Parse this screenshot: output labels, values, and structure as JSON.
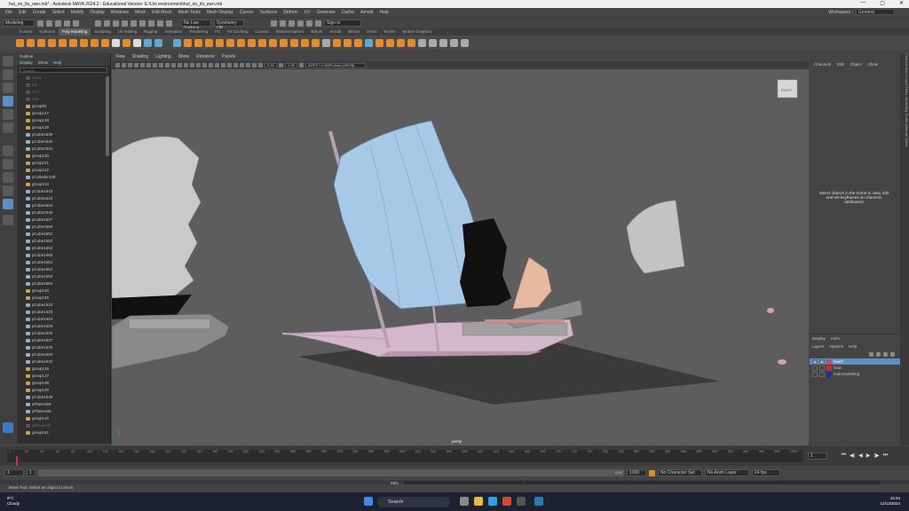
{
  "window": {
    "title": "hut_on_its_own.mb* - Autodesk MAYA 2024.2 - Educational Version: E:\\Uni environment\\hut_on_its_own.mb",
    "controls": [
      "—",
      "▢",
      "✕"
    ]
  },
  "menubar": {
    "items": [
      "File",
      "Edit",
      "Create",
      "Select",
      "Modify",
      "Display",
      "Windows",
      "Mesh",
      "Edit Mesh",
      "Mesh Tools",
      "Mesh Display",
      "Curves",
      "Surfaces",
      "Deform",
      "UV",
      "Generate",
      "Cache",
      "Arnold",
      "Help"
    ],
    "workspace_label": "Workspace :",
    "workspace_value": "General"
  },
  "statusline": {
    "mode": "Modeling",
    "live_surface": "No Live Surface",
    "symmetry": "Symmetry: Off",
    "sign_in": "Sign in"
  },
  "shelf_tabs": [
    "Curves",
    "Surfaces",
    "Poly Modeling",
    "Sculpting",
    "UV Editing",
    "Rigging",
    "Animation",
    "Rendering",
    "FX",
    "FX Caching",
    "Custom",
    "MotionGraphics",
    "Bifrost",
    "Arnold",
    "Bifrost",
    "XGen",
    "MASH",
    "Motion Graphics"
  ],
  "shelf_active": "Poly Modeling",
  "outliner": {
    "title": "Outliner",
    "menu": [
      "Display",
      "Show",
      "Help"
    ],
    "search_placeholder": "Search...",
    "rows": [
      {
        "label": "persp",
        "dim": true
      },
      {
        "label": "top",
        "dim": true
      },
      {
        "label": "front",
        "dim": true
      },
      {
        "label": "side",
        "dim": true
      },
      {
        "label": "group92",
        "grp": true
      },
      {
        "label": "group127",
        "grp": true
      },
      {
        "label": "group128",
        "grp": true
      },
      {
        "label": "group129",
        "grp": true
      },
      {
        "label": "pCube1539"
      },
      {
        "label": "pCube1540"
      },
      {
        "label": "pCube1541"
      },
      {
        "label": "group130",
        "grp": true
      },
      {
        "label": "group131",
        "grp": true
      },
      {
        "label": "group132",
        "grp": true
      },
      {
        "label": "pCylinder128"
      },
      {
        "label": "group133",
        "grp": true
      },
      {
        "label": "pCube1542"
      },
      {
        "label": "pCube1543"
      },
      {
        "label": "pCube1544"
      },
      {
        "label": "pCube1546"
      },
      {
        "label": "pCube1547"
      },
      {
        "label": "pCube1550"
      },
      {
        "label": "pCube1551"
      },
      {
        "label": "pCube1552"
      },
      {
        "label": "pCube1553"
      },
      {
        "label": "pCube1560"
      },
      {
        "label": "pCube1561"
      },
      {
        "label": "pCube1562"
      },
      {
        "label": "pCube1563"
      },
      {
        "label": "pCube1564"
      },
      {
        "label": "group134",
        "grp": true
      },
      {
        "label": "group135",
        "grp": true
      },
      {
        "label": "pCube1622"
      },
      {
        "label": "pCube1623"
      },
      {
        "label": "pCube1624"
      },
      {
        "label": "pCube1625"
      },
      {
        "label": "pCube1626"
      },
      {
        "label": "pCube1627"
      },
      {
        "label": "pCube1628"
      },
      {
        "label": "pCube1629"
      },
      {
        "label": "pCube1632"
      },
      {
        "label": "group136",
        "grp": true
      },
      {
        "label": "group137",
        "grp": true
      },
      {
        "label": "group138",
        "grp": true
      },
      {
        "label": "group139",
        "grp": true
      },
      {
        "label": "pCube1648"
      },
      {
        "label": "pPlane164"
      },
      {
        "label": "pPlane165"
      },
      {
        "label": "group140",
        "grp": true
      },
      {
        "label": "pPlane166",
        "dim": true
      },
      {
        "label": "group141",
        "grp": true
      }
    ]
  },
  "viewport": {
    "menu": [
      "View",
      "Shading",
      "Lighting",
      "Show",
      "Renderer",
      "Panels"
    ],
    "field_a": "0.00",
    "field_b": "1.00",
    "color_space": "ACES 1.0 SDR-video (sRGB)",
    "camera": "persp",
    "viewcube_label": "RIGHT"
  },
  "channelbox": {
    "tabs": [
      "Channels",
      "Edit",
      "Object",
      "Show"
    ],
    "message": "Select objects in the scene to view, edit and set keyframes on channels (attributes)"
  },
  "layers": {
    "tabs": [
      "Display",
      "Anim"
    ],
    "menu": [
      "Layers",
      "Options",
      "Help"
    ],
    "items": [
      {
        "v": "V",
        "p": "P",
        "name": "boat1",
        "color": "#c0506a",
        "selected": true
      },
      {
        "v": "",
        "p": "",
        "name": "boat",
        "color": "#c0302a",
        "selected": false
      },
      {
        "v": "",
        "p": "",
        "name": "mainmodelling",
        "color": "#2030a0",
        "selected": false
      }
    ]
  },
  "sidestrip": {
    "label": "Channel Box / Layer Editor   Modelling Toolkit   Attribute Editor"
  },
  "timeslider": {
    "ticks": [
      "1",
      "10",
      "20",
      "30",
      "40",
      "50",
      "60",
      "70",
      "80",
      "90",
      "100",
      "110",
      "120",
      "130",
      "140",
      "150",
      "160",
      "170",
      "180",
      "190",
      "200",
      "210",
      "220",
      "230",
      "240",
      "250",
      "260",
      "270",
      "280",
      "290",
      "300",
      "310",
      "320",
      "330",
      "340",
      "350",
      "360",
      "370",
      "380",
      "390",
      "400",
      "410",
      "420",
      "430",
      "440",
      "450",
      "460",
      "470",
      "480",
      "490",
      "500",
      "510",
      "520",
      "530",
      "540",
      "550",
      "560",
      "570",
      "580",
      "590",
      "600",
      "610",
      "620",
      "630",
      "640",
      "650",
      "660",
      "670",
      "680",
      "690",
      "700",
      "710",
      "720",
      "730",
      "740",
      "750",
      "760",
      "770",
      "780",
      "790",
      "800",
      "810",
      "820",
      "830",
      "840",
      "850",
      "860",
      "870",
      "880",
      "890",
      "900",
      "910",
      "920",
      "930",
      "940",
      "950",
      "960",
      "970",
      "980",
      "990",
      "1000"
    ],
    "current_frame": "1",
    "controls": [
      "⏮",
      "◀|",
      "◀",
      "▶",
      "|▶",
      "⏭"
    ]
  },
  "rangeslider": {
    "start": "1",
    "start2": "1",
    "range_end": "1000",
    "end": "1000",
    "char_set": "No Character Set",
    "anim_layer": "No Anim Layer",
    "fps": "24 fps"
  },
  "cmdline": {
    "lang": "MEL"
  },
  "helpline": {
    "text": "Move Tool: Select an object to move."
  },
  "taskbar": {
    "temp": "9°C",
    "weather": "Cloudy",
    "search": "Search",
    "time": "15:34",
    "date": "12/12/2024"
  }
}
